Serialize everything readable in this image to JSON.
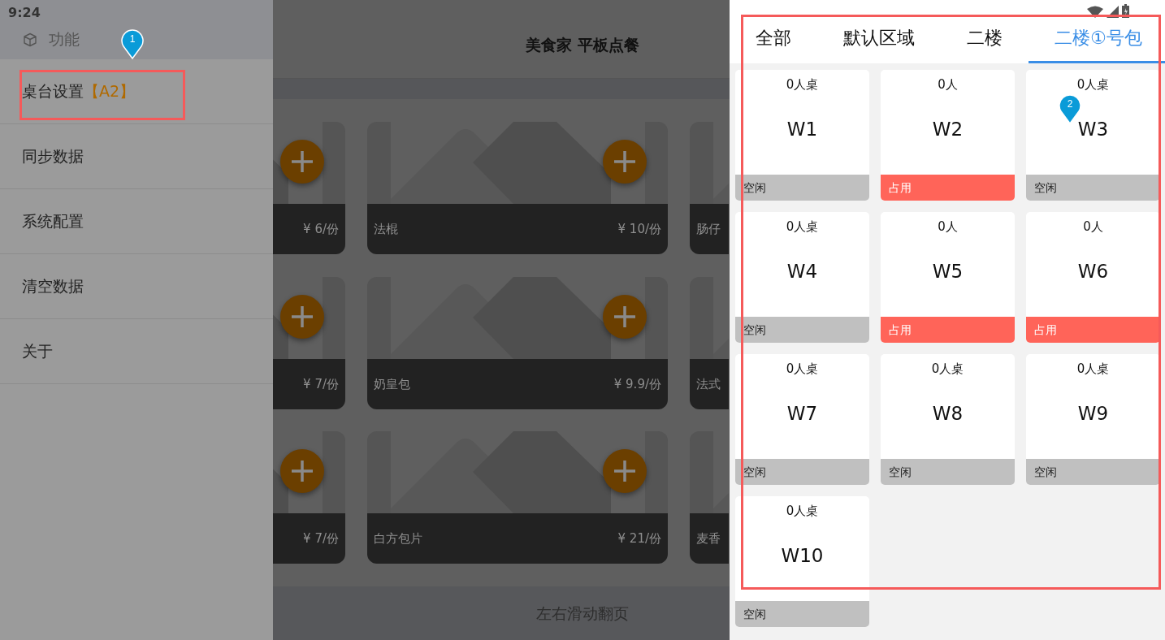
{
  "status_bar": {
    "time": "9:24"
  },
  "drawer": {
    "header": "功能",
    "items": [
      {
        "label": "桌台设置",
        "badge": "【A2】"
      },
      {
        "label": "同步数据"
      },
      {
        "label": "系统配置"
      },
      {
        "label": "清空数据"
      },
      {
        "label": "关于"
      }
    ]
  },
  "app": {
    "title": "美食家 平板点餐",
    "product_rows": [
      [
        {
          "price": "¥ 6/份"
        },
        {
          "name": "法棍",
          "price": "¥ 10/份"
        },
        {
          "name": "肠仔"
        }
      ],
      [
        {
          "price": "¥ 7/份"
        },
        {
          "name": "奶皇包",
          "price": "¥ 9.9/份"
        },
        {
          "name": "法式"
        }
      ],
      [
        {
          "price": "¥ 7/份"
        },
        {
          "name": "白方包片",
          "price": "¥ 21/份"
        },
        {
          "name": "麦香"
        }
      ]
    ],
    "footer": "左右滑动翻页"
  },
  "table_panel": {
    "tabs": [
      {
        "label": "全部",
        "selected": false
      },
      {
        "label": "默认区域",
        "selected": false
      },
      {
        "label": "二楼",
        "selected": false
      },
      {
        "label": "二楼①号包",
        "selected": true
      }
    ],
    "tables": [
      {
        "capacity": "0人桌",
        "name": "W1",
        "status": "空闲",
        "kind": "free"
      },
      {
        "capacity": "0人",
        "name": "W2",
        "status": "占用",
        "kind": "occupied"
      },
      {
        "capacity": "0人桌",
        "name": "W3",
        "status": "空闲",
        "kind": "free"
      },
      {
        "capacity": "0人桌",
        "name": "W4",
        "status": "空闲",
        "kind": "free"
      },
      {
        "capacity": "0人",
        "name": "W5",
        "status": "占用",
        "kind": "occupied"
      },
      {
        "capacity": "0人",
        "name": "W6",
        "status": "占用",
        "kind": "occupied"
      },
      {
        "capacity": "0人桌",
        "name": "W7",
        "status": "空闲",
        "kind": "free"
      },
      {
        "capacity": "0人桌",
        "name": "W8",
        "status": "空闲",
        "kind": "free"
      },
      {
        "capacity": "0人桌",
        "name": "W9",
        "status": "空闲",
        "kind": "free"
      },
      {
        "capacity": "0人桌",
        "name": "W10",
        "status": "空闲",
        "kind": "free"
      }
    ]
  },
  "annotations": [
    {
      "number": "1"
    },
    {
      "number": "2"
    }
  ]
}
